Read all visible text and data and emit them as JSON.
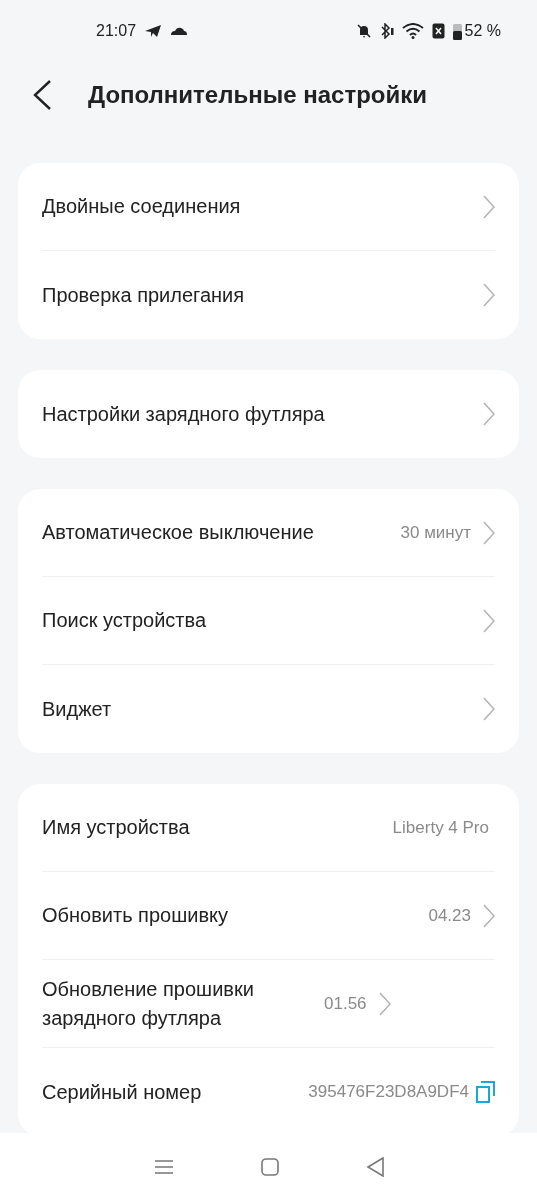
{
  "status_bar": {
    "time": "21:07",
    "battery": "52 %"
  },
  "header": {
    "title": "Дополнительные настройки"
  },
  "groups": [
    {
      "rows": [
        {
          "kind": "nav",
          "label": "Двойные соединения"
        },
        {
          "kind": "nav",
          "label": "Проверка прилегания"
        }
      ]
    },
    {
      "rows": [
        {
          "kind": "nav",
          "label": "Настройки зарядного футляра"
        }
      ]
    },
    {
      "rows": [
        {
          "kind": "nav",
          "label": "Автоматическое выключение",
          "value": "30 минут"
        },
        {
          "kind": "nav",
          "label": "Поиск устройства"
        },
        {
          "kind": "nav",
          "label": "Виджет"
        }
      ]
    },
    {
      "rows": [
        {
          "kind": "info",
          "label": "Имя устройства",
          "value": "Liberty 4 Pro"
        },
        {
          "kind": "nav",
          "label": "Обновить прошивку",
          "value": "04.23"
        },
        {
          "kind": "nav",
          "label": "Обновление прошивки зарядного футляра",
          "value": "01.56"
        },
        {
          "kind": "copy",
          "label": "Серийный номер",
          "value": "395476F23D8A9DF4"
        }
      ]
    }
  ]
}
